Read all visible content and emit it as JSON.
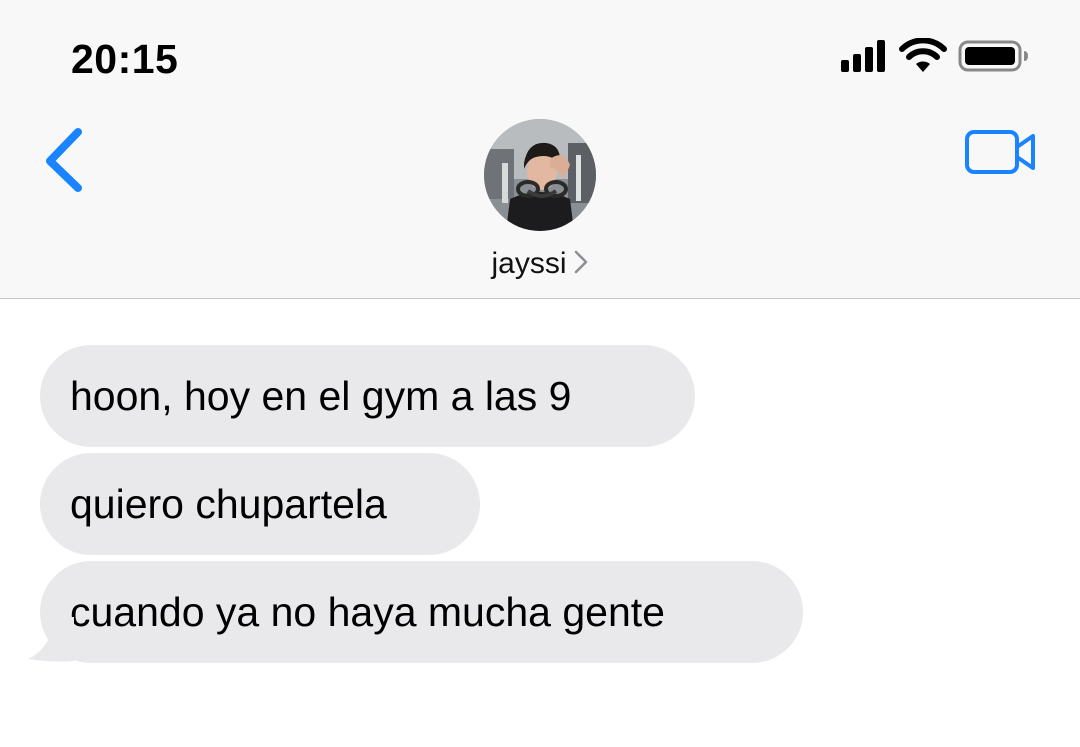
{
  "status_bar": {
    "time": "20:15",
    "icons": [
      "cellular-signal-icon",
      "wifi-icon",
      "battery-icon"
    ]
  },
  "header": {
    "back_icon": "chevron-left-icon",
    "video_icon": "video-camera-icon",
    "contact_name": "jayssi",
    "contact_chevron_icon": "chevron-right-icon",
    "accent_color": "#1a84ff"
  },
  "messages": [
    {
      "direction": "incoming",
      "text": "hoon, hoy en el gym a las 9"
    },
    {
      "direction": "incoming",
      "text": "quiero chupartela"
    },
    {
      "direction": "incoming",
      "text": "cuando ya no haya mucha gente"
    }
  ],
  "colors": {
    "incoming_bubble": "#e9e9eb",
    "header_bg": "#f8f8f8"
  }
}
